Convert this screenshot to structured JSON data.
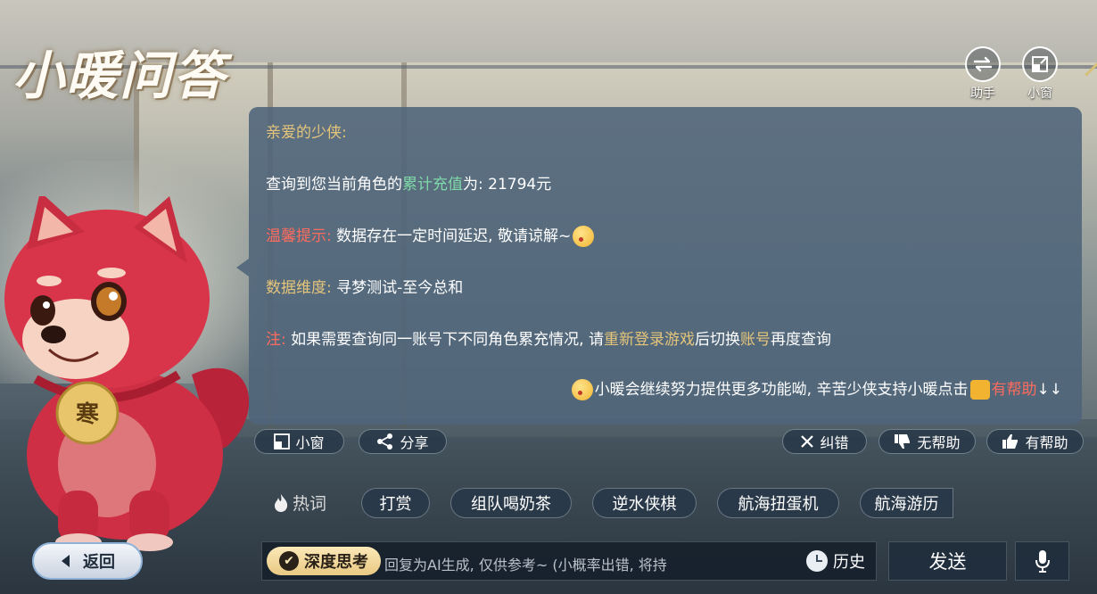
{
  "header": {
    "title": "小暖问答",
    "assistant_label": "助手",
    "mini_window_label": "小窗"
  },
  "message": {
    "greeting": "亲爱的少侠:",
    "query_prefix": "查询到您当前角色的",
    "query_highlight": "累计充值",
    "query_suffix": "为: 21794元",
    "tip_label": "温馨提示:",
    "tip_text": " 数据存在一定时间延迟, 敬请谅解~",
    "dimension_label": "数据维度:",
    "dimension_text": " 寻梦测试-至今总和",
    "note_label": "注:",
    "note_text_1": " 如果需要查询同一账号下不同角色累充情况, 请",
    "note_highlight_1": "重新登录游戏",
    "note_text_2": "后切换",
    "note_highlight_2": "账号",
    "note_text_3": "再度查询",
    "closing_text": "小暖会继续努力提供更多功能呦, 辛苦少侠支持小暖点击",
    "closing_highlight": "有帮助",
    "closing_arrows": "↓↓"
  },
  "actions": {
    "mini_window": "小窗",
    "share": "分享",
    "correct": "纠错",
    "not_helpful": "无帮助",
    "helpful": "有帮助"
  },
  "hot_words": {
    "label": "热词",
    "items": [
      "打赏",
      "组队喝奶茶",
      "逆水侠棋",
      "航海扭蛋机",
      "航海游历"
    ]
  },
  "bottom": {
    "back": "返回",
    "deep_think": "深度思考",
    "placeholder": "回复为AI生成, 仅供参考~ (小概率出错, 将持",
    "history": "历史",
    "send": "发送"
  },
  "mascot": {
    "tag_char": "寒"
  },
  "colors": {
    "bubble": "#4e647a",
    "gold": "#e5c57a",
    "green": "#7fd9a8",
    "red": "#ff6b5e"
  }
}
